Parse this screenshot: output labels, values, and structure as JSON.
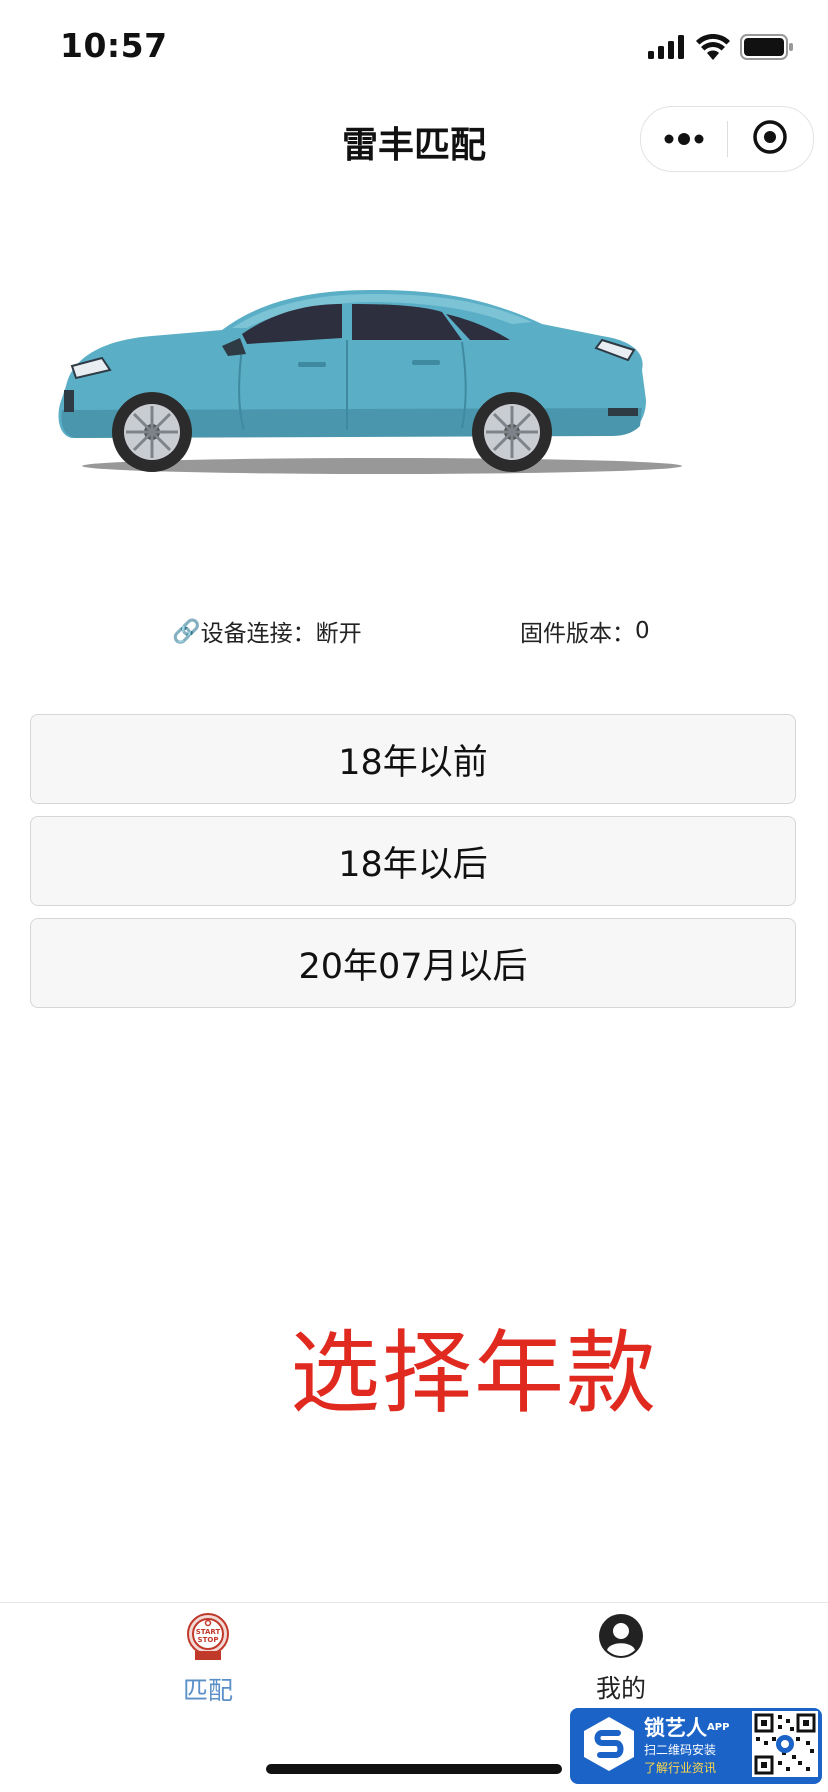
{
  "status_bar": {
    "time": "10:57"
  },
  "nav": {
    "title": "雷丰匹配",
    "capsule_icons": [
      "more-dots-icon",
      "record-target-icon"
    ]
  },
  "device": {
    "link_icon": "🔗",
    "connection_label": "设备连接：",
    "connection_value": "断开",
    "firmware_label": "固件版本：",
    "firmware_value": "0"
  },
  "year_options": [
    {
      "label": "18年以前"
    },
    {
      "label": "18年以后"
    },
    {
      "label": "20年07月以后"
    }
  ],
  "annotation": "选择年款",
  "tabbar": {
    "tabs": [
      {
        "label": "匹配",
        "icon": "start-stop-icon",
        "active": true,
        "color": "#5b8fc7"
      },
      {
        "label": "我的",
        "icon": "user-profile-icon",
        "active": false,
        "color": "#222222"
      }
    ]
  },
  "watermark": {
    "brand": "锁艺人",
    "brand_suffix": "APP",
    "line1": "扫二维码安装",
    "line2": "了解行业资讯"
  },
  "colors": {
    "accent_red": "#e02a20",
    "tab_active": "#5b8fc7",
    "car_body": "#5aaec6",
    "watermark_bg": "#1b63c6"
  }
}
